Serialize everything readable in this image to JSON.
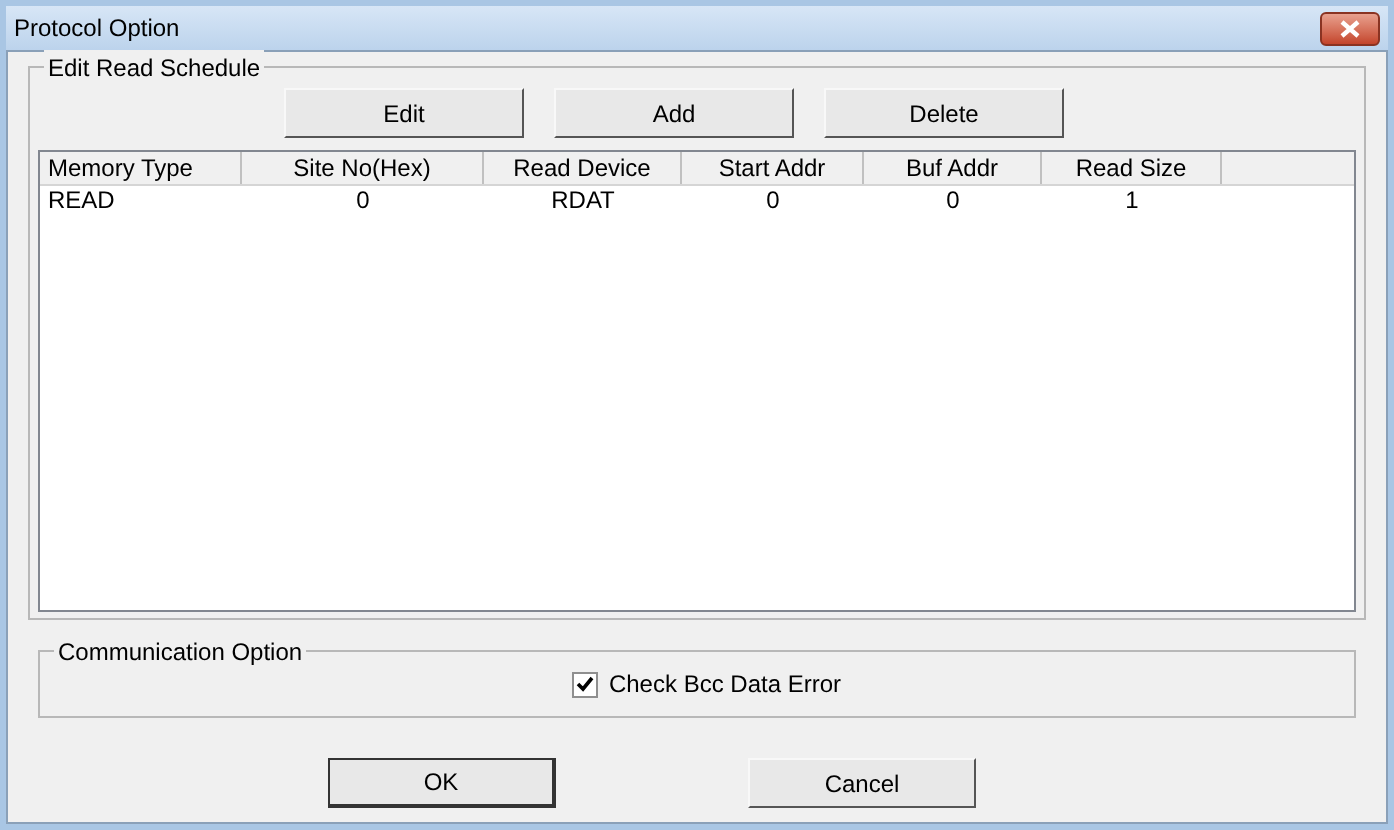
{
  "window": {
    "title": "Protocol Option"
  },
  "schedule": {
    "title": "Edit Read Schedule",
    "buttons": [
      "Edit",
      "Add",
      "Delete"
    ],
    "table": {
      "columns": [
        "Memory Type",
        "Site No(Hex)",
        "Read Device",
        "Start Addr",
        "Buf Addr",
        "Read Size"
      ],
      "rows": [
        [
          "READ",
          "0",
          "RDAT",
          "0",
          "0",
          "1"
        ]
      ]
    }
  },
  "communication": {
    "title": "Communication Option",
    "checkbox": {
      "label": "Check Bcc Data Error",
      "checked": true
    }
  },
  "buttons": [
    {
      "label": "OK",
      "default": true
    },
    {
      "label": "Cancel",
      "default": false
    }
  ]
}
